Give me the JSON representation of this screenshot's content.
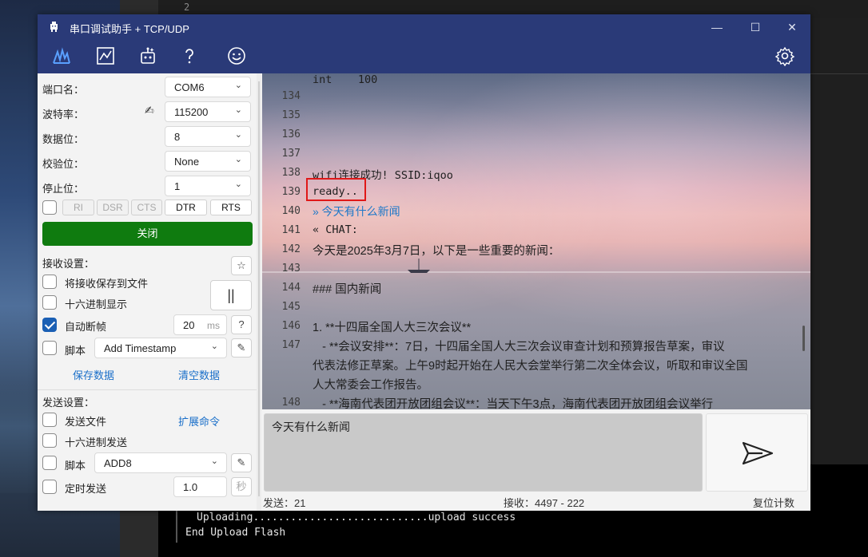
{
  "background": {
    "editor_line_number": "2",
    "terminal_lines": [
      "Uploading............................upload success",
      "End Upload Flash"
    ]
  },
  "window": {
    "title": "串口调试助手 + TCP/UDP",
    "controls": [
      "—",
      "☐",
      "✕"
    ]
  },
  "toolbar": {
    "icons": [
      "wave-icon",
      "chart-icon",
      "robot-icon",
      "help-icon",
      "smile-icon",
      "gear-icon"
    ]
  },
  "serial": {
    "port_label": "端口名：",
    "port_value": "COM6",
    "baud_label": "波特率：",
    "baud_value": "115200",
    "databits_label": "数据位：",
    "databits_value": "8",
    "parity_label": "校验位：",
    "parity_value": "None",
    "stopbits_label": "停止位：",
    "stopbits_value": "1",
    "signals": [
      "RI",
      "DSR",
      "CTS",
      "DTR",
      "RTS"
    ],
    "close_label": "关闭"
  },
  "receive_settings": {
    "title": "接收设置：",
    "star_label": "☆",
    "save_to_file": "将接收保存到文件",
    "hex_display": "十六进制显示",
    "auto_frame": "自动断帧",
    "auto_frame_checked": true,
    "auto_frame_value": "20",
    "auto_frame_unit": "ms",
    "help_label": "?",
    "pause_label": "||",
    "script_label": "脚本",
    "script_value": "Add Timestamp",
    "save_data": "保存数据",
    "clear_data": "清空数据"
  },
  "send_settings": {
    "title": "发送设置：",
    "send_file": "发送文件",
    "ext_cmd": "扩展命令",
    "hex_send": "十六进制发送",
    "script_label": "脚本",
    "script_value": "ADD8",
    "timed_send": "定时发送",
    "timed_value": "1.0",
    "timed_unit": "秒"
  },
  "receive_lines": [
    {
      "num": "",
      "text": "int    100"
    },
    {
      "num": "134",
      "text": ""
    },
    {
      "num": "135",
      "text": ""
    },
    {
      "num": "136",
      "text": ""
    },
    {
      "num": "137",
      "text": ""
    },
    {
      "num": "138",
      "text": "wifi连接成功! SSID:iqoo"
    },
    {
      "num": "139",
      "text": "ready.."
    },
    {
      "num": "140",
      "text": "» 今天有什么新闻"
    },
    {
      "num": "141",
      "text": "« CHAT:"
    },
    {
      "num": "142",
      "text": "今天是2025年3月7日，以下是一些重要的新闻："
    },
    {
      "num": "143",
      "text": ""
    },
    {
      "num": "144",
      "text": "### 国内新闻"
    },
    {
      "num": "145",
      "text": ""
    },
    {
      "num": "146",
      "text": "1. **十四届全国人大三次会议**"
    },
    {
      "num": "147",
      "text": "   - **会议安排**：7日，十四届全国人大三次会议审查计划和预算报告草案，审议"
    },
    {
      "num": "",
      "text": "代表法修正草案。上午9时起开始在人民大会堂举行第二次全体会议，听取和审议全国"
    },
    {
      "num": "",
      "text": "人大常委会工作报告。"
    },
    {
      "num": "148",
      "text": "   - **海南代表团开放团组会议**：当天下午3点，海南代表团开放团组会议举行"
    }
  ],
  "send_input": {
    "value": "今天有什么新闻"
  },
  "status": {
    "sent": "发送：21",
    "received": "接收：4497 - 222",
    "reset": "复位计数"
  }
}
